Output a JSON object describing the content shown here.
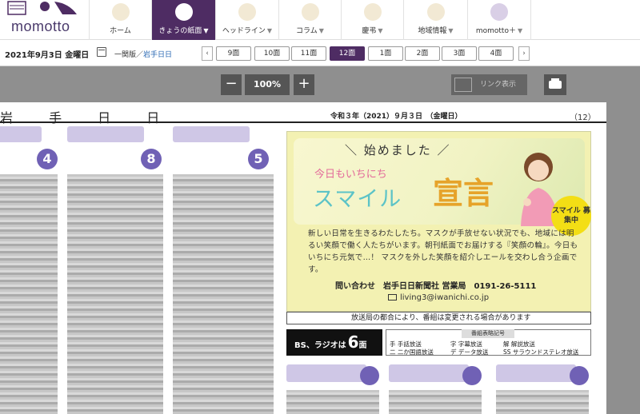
{
  "logo": {
    "text": "momotto"
  },
  "nav": [
    {
      "label": "ホーム",
      "icon": "home-icon",
      "caret": ""
    },
    {
      "label": "きょうの紙面",
      "icon": "newspaper-icon",
      "caret": "▼"
    },
    {
      "label": "ヘッドライン",
      "icon": "headline-icon",
      "caret": "▼"
    },
    {
      "label": "コラム",
      "icon": "pen-icon",
      "caret": "▼"
    },
    {
      "label": "慶弔",
      "icon": "flower-icon",
      "caret": "▼"
    },
    {
      "label": "地域情報",
      "icon": "bulb-icon",
      "caret": "▼"
    },
    {
      "label": "momotto＋",
      "icon": "mplus-icon",
      "caret": "▼"
    }
  ],
  "datebar": {
    "date": "2021年9月3日 金曜日",
    "edition": "一関版／",
    "region": "岩手日日",
    "prev": "‹",
    "next": "›",
    "pages": [
      "9面",
      "10面",
      "11面",
      "12面",
      "1面",
      "2面",
      "3面",
      "4面"
    ],
    "selected_page": "12面"
  },
  "toolbar": {
    "zoom_out": "−",
    "zoom": "100%",
    "zoom_in": "+",
    "link_view": "リンク表示"
  },
  "page": {
    "masthead": "岩 手 日 日",
    "info": "令和３年（2021）９月３日　（金曜日）",
    "number": "（12）",
    "column_numbers": [
      "4",
      "8",
      "5"
    ]
  },
  "ad": {
    "start": "＼ 始めました ／",
    "today": "今日もいちにち",
    "smile": "スマイル",
    "sengen": "宣言",
    "badge": "スマイル 募集中",
    "body": "新しい日常を生きるわたしたち。マスクが手放せない状況でも、地域には明るい笑顔で働く人たちがいます。朝刊紙面でお届けする『笑顔の輪』。今日もいちにち元気で…！ マスクを外した笑顔を紹介しエールを交わし合う企画です。",
    "contact": "問い合わせ　岩手日日新聞社 営業局　0191-26-5111",
    "email": "living3@iwanichi.co.jp"
  },
  "notice": "放送局の都合により、番組は変更される場合があります",
  "bs": {
    "prefix": "BS、ラジオは",
    "num": "6",
    "suffix": "面"
  },
  "codes": {
    "title": "番組表略記号",
    "items": [
      "手 手話放送",
      "二 二か国語放送",
      "字 字幕放送",
      "デ データ放送",
      "解 解説放送",
      "SS サラウンドステレオ放送"
    ]
  }
}
